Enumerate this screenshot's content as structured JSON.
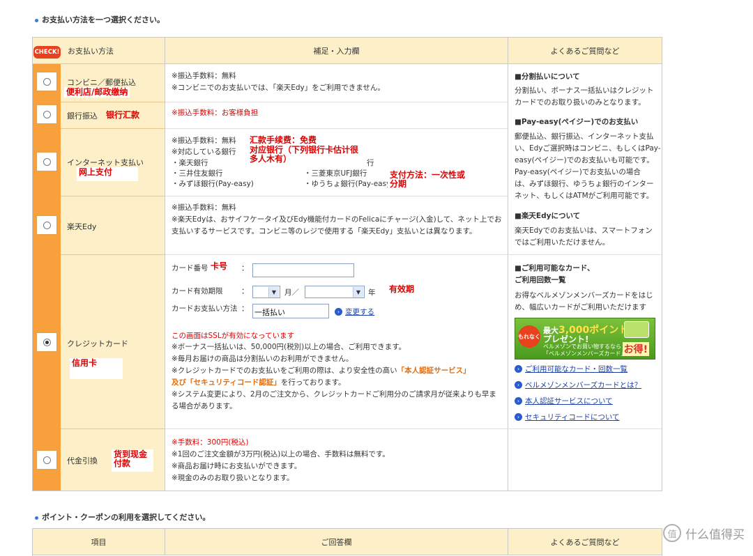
{
  "section1_title": "お支払い方法を一つ選択ください。",
  "check_badge": "CHECK!",
  "headers": {
    "method": "お支払い方法",
    "detail": "補足・入力欄",
    "faq": "よくあるご質問など"
  },
  "rows": [
    {
      "key": "convenience",
      "method": "コンビニ／郵便払込",
      "note": "便利店/邮政缴纳",
      "selected": false,
      "lines": [
        "※振込手数料：無料",
        "※コンビニでのお支払いでは、「楽天Edy」をご利用できません。"
      ]
    },
    {
      "key": "bank",
      "method": "銀行振込",
      "note": "银行汇款",
      "selected": false,
      "lines": [
        "※振込手数料：お客様負担"
      ]
    },
    {
      "key": "internet",
      "method": "インターネット支払い",
      "note": "网上支付",
      "selected": false,
      "lines": [
        "※振込手数料：無料",
        "※対応している銀行",
        "・楽天銀行",
        "・三井住友銀行",
        "・みずほ銀行(Pay-easy)"
      ],
      "lines_col2": [
        "行",
        "・三菱東京UFJ銀行",
        "・ゆうちょ銀行(Pay-easy)"
      ],
      "note_fee": "汇款手续费：免费",
      "note_banks": "对应银行（下列银行卡估计很多人木有）",
      "note_method": "支付方法：一次性或分期"
    },
    {
      "key": "edy",
      "method": "楽天Edy",
      "selected": false,
      "lines": [
        "※振込手数料：無料",
        "※楽天Edyは、おサイフケータイ及びEdy機能付カードのFelicaにチャージ(入金)して、ネット上でお",
        "支払いするサービスです。コンビニ等のレジで使用する「楽天Edy」支払いとは異なります。"
      ]
    },
    {
      "key": "credit",
      "method": "クレジットカード",
      "note": "信用卡",
      "selected": true,
      "form": {
        "card_number_label": "カード番号",
        "card_number_note": "卡号",
        "expiry_label": "カード有効期限",
        "month_unit": "月／",
        "year_unit": "年",
        "expiry_note": "有效期",
        "pay_method_label": "カードお支払い方法",
        "pay_method_value": "一括払い",
        "change_link": "変更する",
        "colon": "："
      },
      "ssl_note": "この画面はSSLが有効になっています",
      "lines": [
        "※ボーナス一括払いは、50,000円(税別)以上の場合、ご利用できます。",
        "※毎月お届けの商品は分割払いのお利用ができません。"
      ],
      "auth_line_prefix": "※クレジットカードでのお支払いをご利用の際は、より安全性の高い",
      "auth_service": "「本人認証サービス」",
      "security_code": "及び「セキュリティコード認証」",
      "auth_line_suffix": "を行っております。",
      "lines_after": [
        "※システム変更により、2月のご注文から、クレジットカードご利用分のご請求月が従来よりも早ま",
        "る場合があります。"
      ]
    },
    {
      "key": "cod",
      "method": "代金引換",
      "note": "货到现金付款",
      "selected": false,
      "fee_line": "※手数料：300円(税込)",
      "lines": [
        "※1回のご注文金額が3万円(税込)以上の場合、手数料は無料です。",
        "※商品お届け時にお支払いができます。",
        "※現金のみのお取り扱いとなります。"
      ]
    }
  ],
  "faq": {
    "installment_title": "■分割払いについて",
    "installment_text": [
      "分割払い、ボーナス一括払いはクレジット",
      "カードでのお取り扱いのみとなります。"
    ],
    "payeasy_title": "■Pay-easy(ペイジー)でのお支払い",
    "payeasy_text": [
      "郵便払込、銀行振込、インターネット支払",
      "い、Edyご選択時はコンビニ、もしくはPay-",
      "easy(ペイジー)でのお支払いも可能です。",
      "Pay-easy(ペイジー)でお支払いの場合",
      "は、みずほ銀行、ゆうちょ銀行のインター",
      "ネット、もしくはATMがご利用可能です。"
    ],
    "edy_title": "■楽天Edyについて",
    "edy_text": [
      "楽天Edyでのお支払いは、スマートフォン",
      "ではご利用いただけません。"
    ],
    "cards_title": [
      "■ご利用可能なカード、",
      "ご利用回数一覧"
    ],
    "cards_text": [
      "お得なベルメゾンメンバーズカードをはじ",
      "め、幅広いカードがご利用いただけます"
    ],
    "banner": {
      "circle": "もれなく",
      "main_prefix": "最大",
      "main_points": "3,000ポイント",
      "main_suffix": "プレゼント!",
      "sub1": "ベルメゾンでお買い物するなら",
      "sub2": "「ベルメゾンメンバーズカード」が",
      "otoku": "お得!"
    },
    "links": [
      "ご利用可能なカード・回数一覧",
      "ベルメゾンメンバーズカードとは？",
      "本人認証サービスについて",
      "セキュリティコードについて"
    ]
  },
  "section2_title": "ポイント・クーポンの利用を選択してください。",
  "headers2": {
    "item": "項目",
    "answer": "ご回答欄",
    "faq": "よくあるご質問など"
  },
  "watermark": "什么值得买",
  "watermark_icon": "值",
  "colors": {
    "orange_strip": "#f7a03c",
    "header_bg": "#fdf0c8",
    "note_red": "#e00000",
    "link_blue": "#1a3fa8"
  }
}
